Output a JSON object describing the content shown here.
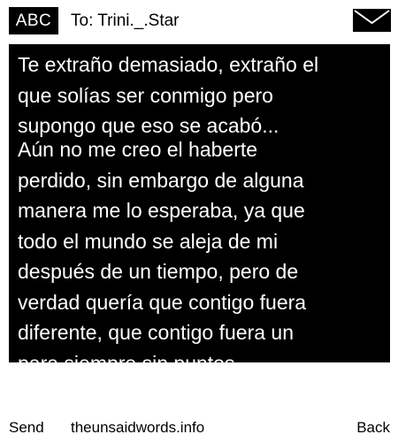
{
  "header": {
    "input_mode": "ABC",
    "recipient_line": "To: Trini._.Star",
    "mail_icon": "envelope-icon"
  },
  "message": {
    "part_1": "Te extraño demasiado, extraño el\nque solías ser conmigo pero\nsupongo que eso se acabó...",
    "part_2": "Aún no me creo el haberte\nperdido, sin embargo de alguna\nmanera me lo esperaba, ya que\ntodo el mundo se aleja de mi\ndespués de un tiempo, pero de\nverdad quería que contigo fuera\ndiferente, que contigo fuera un\npara siempre sin puntos"
  },
  "softkeys": {
    "left": "Send",
    "center": "theunsaidwords.info",
    "right": "Back"
  },
  "colors": {
    "background": "#ffffff",
    "message_background": "#000000",
    "message_text": "#ffffff",
    "text": "#000000"
  }
}
